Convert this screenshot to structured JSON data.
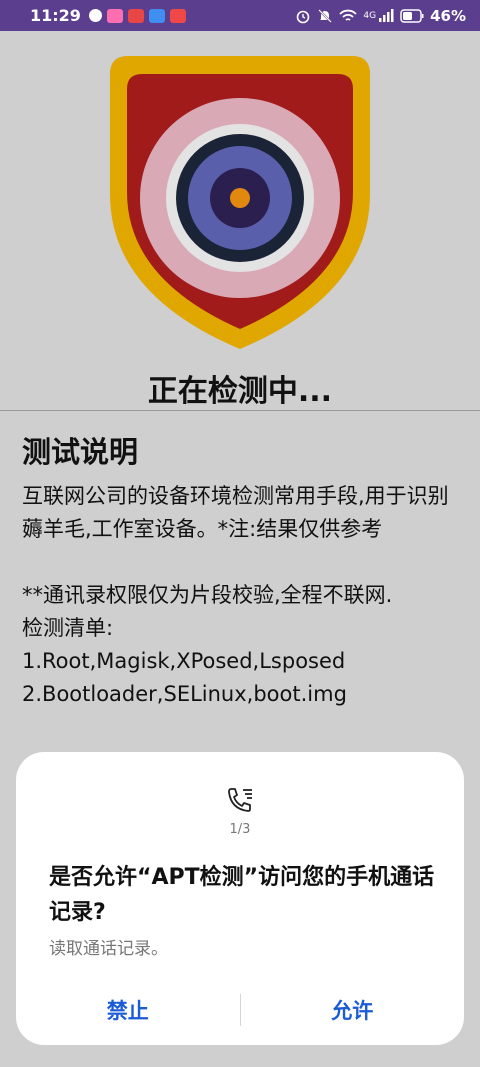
{
  "status_bar": {
    "time": "11:29",
    "network": "4G",
    "battery": "46%",
    "notification_icons": [
      "wechat-icon",
      "app-icon",
      "app-icon",
      "app-icon",
      "app-icon"
    ]
  },
  "detect_title": "正在检测中...",
  "description": {
    "heading": "测试说明",
    "body": "互联网公司的设备环境检测常用手段,用于识别薅羊毛,工作室设备。*注:结果仅供参考\n\n**通讯录权限仅为片段校验,全程不联网.\n检测清单:\n1.Root,Magisk,XPosed,Lsposed\n2.Bootloader,SELinux,boot.img"
  },
  "dialog": {
    "icon": "call-log-icon",
    "page_indicator": "1/3",
    "title": "是否允许“APT检测”访问您的手机通话记录?",
    "subtitle": "读取通话记录。",
    "deny_label": "禁止",
    "allow_label": "允许"
  },
  "colors": {
    "status_bar": "#5b3e8e",
    "accent": "#1a5bd6",
    "shield_gold": "#e0a700",
    "shield_red": "#a11b1b"
  }
}
